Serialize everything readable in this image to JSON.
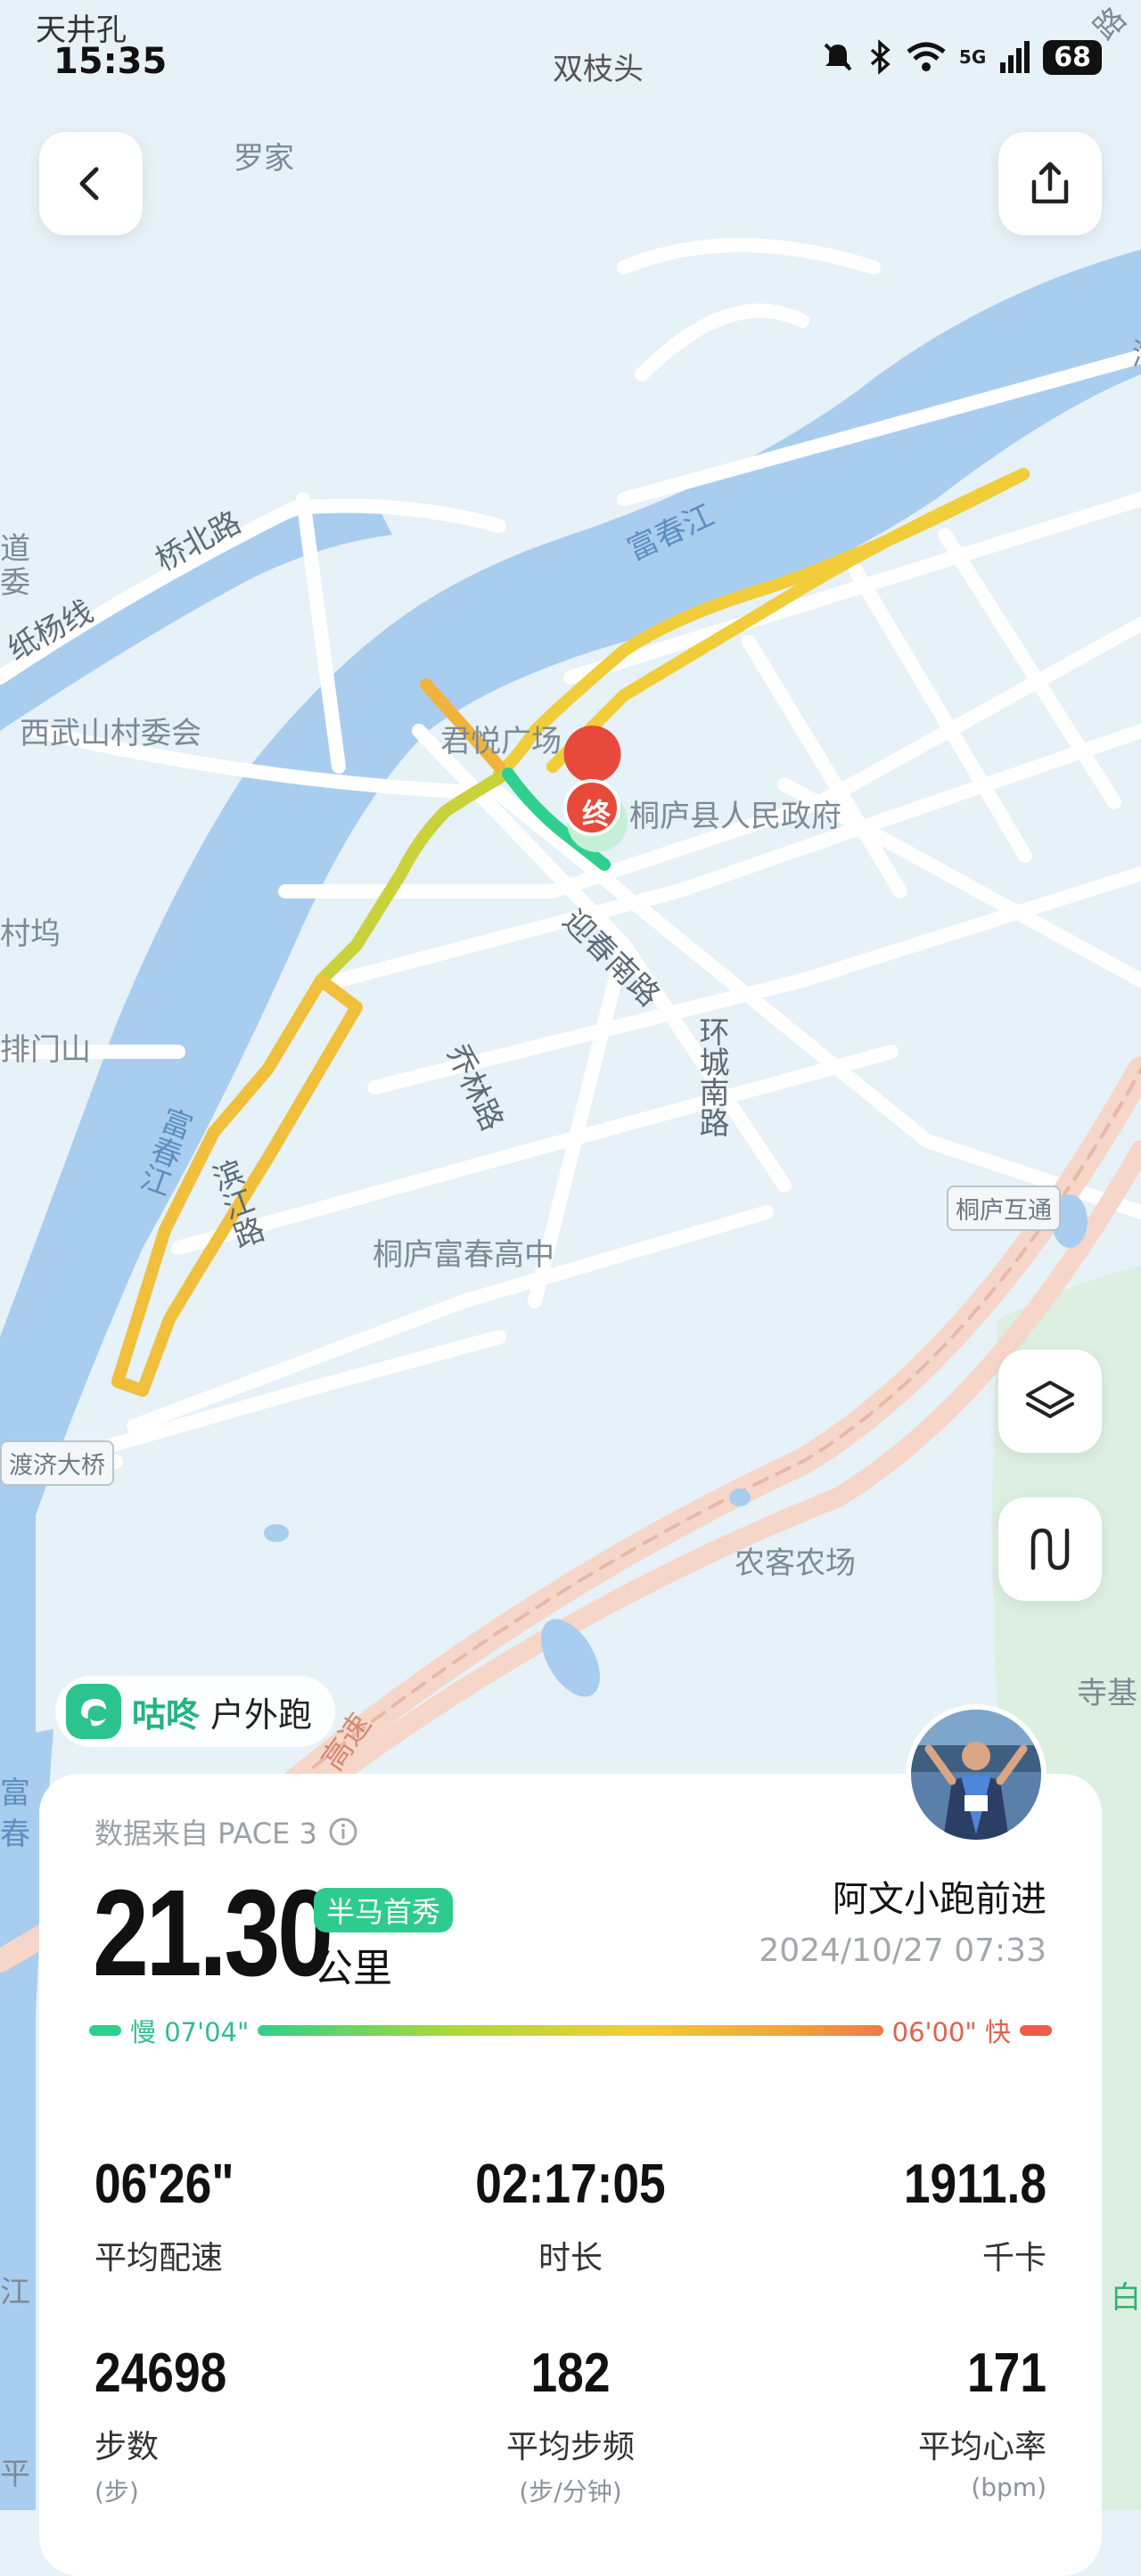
{
  "status_bar": {
    "carrier": "天井孔",
    "time": "15:35",
    "center_place": "双枝头",
    "network": "5G",
    "battery": "68"
  },
  "map": {
    "labels": {
      "luojia": "罗家",
      "fuchunjiang_top": "富春江",
      "qiaobeilu": "桥北路",
      "zhiyangxian": "纸杨线",
      "dao": "道",
      "wei": "委",
      "xiwushan": "西武山村委会",
      "junyue": "君悦广场",
      "govt": "桐庐县人民政府",
      "yingchunnanlu": "迎春南路",
      "qiaolinlu": "乔林路",
      "huanchengnanlu": "环城南路",
      "cunwu": "村坞",
      "paimenshan": "排门山",
      "fuchunjiang_left": "富春江",
      "binjianglu": "滨江路",
      "fuchun_gaozhong": "桐庐富春高中",
      "tonglu_hutong": "桐庐互通",
      "duji_daqiao": "渡济大桥",
      "nongke": "农客农场",
      "gaosu": "高速",
      "siji": "寺基",
      "bai": "白",
      "jiang": "江",
      "ping": "平",
      "hu": "湖",
      "lu": "路",
      "fu2": "富",
      "chun2": "春"
    },
    "end_marker": "终",
    "route_pace_colors": {
      "slow": "#2fcf8e",
      "mid": "#f1cd3a",
      "fast": "#ef7a4a"
    }
  },
  "buttons": {
    "back": "back",
    "share": "share",
    "layers": "layers",
    "route": "route"
  },
  "source_chip": {
    "brand": "咕咚",
    "activity": "户外跑"
  },
  "summary": {
    "data_source": "数据来自 PACE 3",
    "distance": "21.30",
    "badge": "半马首秀",
    "unit": "公里",
    "user_name": "阿文小跑前进",
    "date": "2024/10/27 07:33",
    "pace_slow_label": "慢 07'04\"",
    "pace_fast_label": "06'00\" 快",
    "pace_slow_color": "#2fcf8e",
    "pace_fast_color": "#ef5a4a"
  },
  "stats": [
    {
      "value": "06'26\"",
      "label": "平均配速",
      "sub": ""
    },
    {
      "value": "02:17:05",
      "label": "时长",
      "sub": ""
    },
    {
      "value": "1911.8",
      "label": "千卡",
      "sub": ""
    },
    {
      "value": "24698",
      "label": "步数",
      "sub": "(步)"
    },
    {
      "value": "182",
      "label": "平均步频",
      "sub": "(步/分钟)"
    },
    {
      "value": "171",
      "label": "平均心率",
      "sub": "(bpm)"
    }
  ]
}
